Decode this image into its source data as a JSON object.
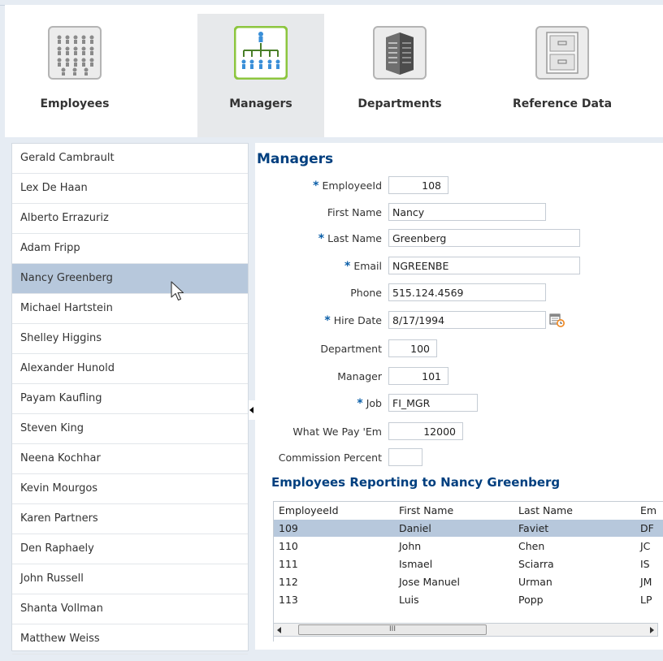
{
  "nav": {
    "tabs": [
      {
        "label": "Employees",
        "icon": "people-grid-icon"
      },
      {
        "label": "Managers",
        "icon": "org-chart-icon"
      },
      {
        "label": "Departments",
        "icon": "building-icon"
      },
      {
        "label": "Reference Data",
        "icon": "file-cabinet-icon"
      }
    ],
    "active": "Managers"
  },
  "sidebar": {
    "employees": [
      "Gerald  Cambrault",
      "Lex  De Haan",
      "Alberto  Errazuriz",
      "Adam  Fripp",
      "Nancy  Greenberg",
      "Michael  Hartstein",
      "Shelley  Higgins",
      "Alexander  Hunold",
      "Payam  Kaufling",
      "Steven  King",
      "Neena  Kochhar",
      "Kevin  Mourgos",
      "Karen  Partners",
      "Den  Raphaely",
      "John  Russell",
      "Shanta  Vollman",
      "Matthew  Weiss"
    ],
    "selected": "Nancy  Greenberg"
  },
  "form": {
    "title": "Managers",
    "fields": [
      {
        "label": "EmployeeId",
        "required": true,
        "value": "108"
      },
      {
        "label": "First Name",
        "required": false,
        "value": "Nancy"
      },
      {
        "label": "Last Name",
        "required": true,
        "value": "Greenberg"
      },
      {
        "label": "Email",
        "required": true,
        "value": "NGREENBE"
      },
      {
        "label": "Phone",
        "required": false,
        "value": "515.124.4569"
      },
      {
        "label": "Hire Date",
        "required": true,
        "value": "8/17/1994"
      },
      {
        "label": "Department",
        "required": false,
        "value": "100"
      },
      {
        "label": "Manager",
        "required": false,
        "value": "101"
      },
      {
        "label": "Job",
        "required": true,
        "value": "FI_MGR"
      },
      {
        "label": "What We Pay 'Em",
        "required": false,
        "value": "12000"
      },
      {
        "label": "Commission Percent",
        "required": false,
        "value": ""
      }
    ],
    "required_marker": "*",
    "calendar_icon": "calendar-icon"
  },
  "reports": {
    "title": "Employees Reporting to Nancy Greenberg",
    "columns": [
      "EmployeeId",
      "First Name",
      "Last Name",
      "Em"
    ],
    "rows": [
      [
        "109",
        "Daniel",
        "Faviet",
        "DF"
      ],
      [
        "110",
        "John",
        "Chen",
        "JC"
      ],
      [
        "111",
        "Ismael",
        "Sciarra",
        "IS"
      ],
      [
        "112",
        "Jose Manuel",
        "Urman",
        "JM"
      ],
      [
        "113",
        "Luis",
        "Popp",
        "LP"
      ]
    ],
    "selected_row": 0,
    "scroll_grip": "III"
  },
  "colors": {
    "heading": "#003f7f",
    "selection": "#b7c8dc",
    "required": "#0a5ea8",
    "active_tab": "#e7e9eb"
  }
}
